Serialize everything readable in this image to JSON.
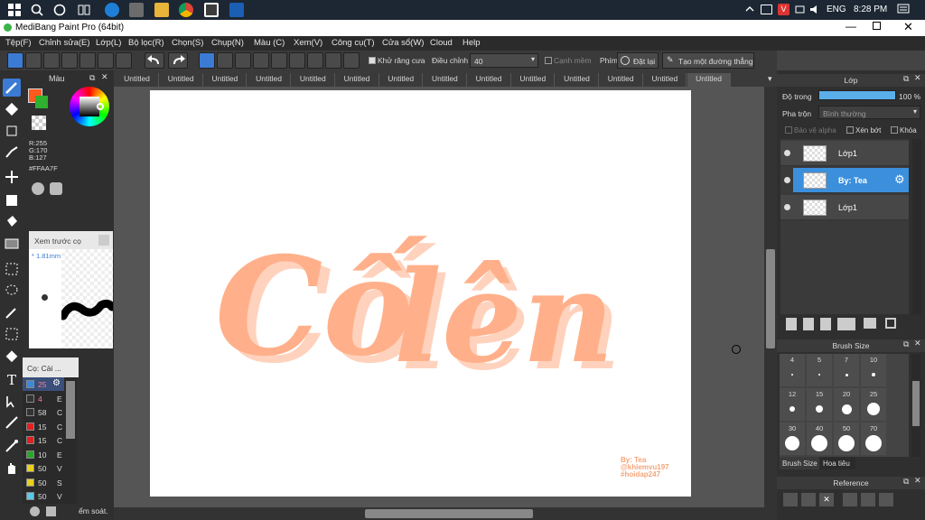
{
  "taskbar": {
    "language": "ENG",
    "time": "8:28 PM"
  },
  "window": {
    "title": "MediBang Paint Pro (64bit)"
  },
  "menu": [
    {
      "label": "Tệp(F)"
    },
    {
      "label": "Chỉnh sửa(E)"
    },
    {
      "label": "Lớp(L)"
    },
    {
      "label": "Bộ lọc(R)"
    },
    {
      "label": "Chọn(S)"
    },
    {
      "label": "Chụp(N)"
    },
    {
      "label": "Màu (C)"
    },
    {
      "label": "Xem(V)"
    },
    {
      "label": "Công cụ(T)"
    },
    {
      "label": "Cửa sổ(W)"
    },
    {
      "label": "Cloud"
    },
    {
      "label": "Help"
    }
  ],
  "toolbar": {
    "antialias_label": "Khử răng cưa",
    "adjust_label": "Điều chỉnh",
    "adjust_value": "40",
    "edge_label": "Cạnh mềm",
    "key_label": "Phím",
    "reset_label": "Đặt lại",
    "straight_line_label": "Tạo một đường thẳng"
  },
  "color": {
    "panel_title": "Màu",
    "r": "R:255",
    "g": "G:170",
    "b": "B:127",
    "hex": "#FFAA7F",
    "primary": "#ff5a1e",
    "secondary": "#2fb02f"
  },
  "preview": {
    "title": "Xem trước cọ",
    "size": "* 1.81mm"
  },
  "brushlist": {
    "title": "Cọ: Cài ...",
    "items": [
      {
        "size": "25",
        "color": "#3a8ad8",
        "text": ""
      },
      {
        "size": "4",
        "color": "#333333",
        "text": "E"
      },
      {
        "size": "58",
        "color": "#333333",
        "text": "C"
      },
      {
        "size": "15",
        "color": "#e02020",
        "text": "C"
      },
      {
        "size": "15",
        "color": "#e02020",
        "text": "C"
      },
      {
        "size": "10",
        "color": "#2aa52a",
        "text": "E"
      },
      {
        "size": "50",
        "color": "#e8d020",
        "text": "V"
      },
      {
        "size": "50",
        "color": "#e8d020",
        "text": "S"
      },
      {
        "size": "50",
        "color": "#5bc8e8",
        "text": "V"
      }
    ],
    "footer": "ểm soát."
  },
  "tabs": [
    {
      "label": "Untitled"
    },
    {
      "label": "Untitled"
    },
    {
      "label": "Untitled"
    },
    {
      "label": "Untitled"
    },
    {
      "label": "Untitled"
    },
    {
      "label": "Untitled"
    },
    {
      "label": "Untitled"
    },
    {
      "label": "Untitled"
    },
    {
      "label": "Untitled"
    },
    {
      "label": "Untitled"
    },
    {
      "label": "Untitled"
    },
    {
      "label": "Untitled"
    },
    {
      "label": "Untitled"
    },
    {
      "label": "Untitled"
    }
  ],
  "canvas": {
    "word1": "Cố",
    "word2": "lên",
    "signature_line1": "By: Tea",
    "signature_line2": "@khiemvu197",
    "signature_line3": "#hoidap247",
    "ink_color": "#ffb08a",
    "shadow_color": "#ffd2bd"
  },
  "layers": {
    "title": "Lớp",
    "opacity_label": "Độ trong",
    "opacity_value": "100 %",
    "blend_label": "Pha trộn",
    "blend_value": "Bình thường",
    "protect_alpha": "Bảo vệ alpha",
    "clip": "Xén bớt",
    "lock": "Khóa",
    "items": [
      {
        "name": "Lớp1"
      },
      {
        "name": "By: Tea"
      },
      {
        "name": "Lớp1"
      }
    ]
  },
  "brushsize": {
    "title": "Brush Size",
    "sizes": [
      "4",
      "5",
      "7",
      "10",
      "12",
      "15",
      "20",
      "25",
      "30",
      "40",
      "50",
      "70"
    ],
    "tab1": "Brush Size",
    "tab2": "Hoa tiêu"
  },
  "reference": {
    "title": "Reference"
  }
}
